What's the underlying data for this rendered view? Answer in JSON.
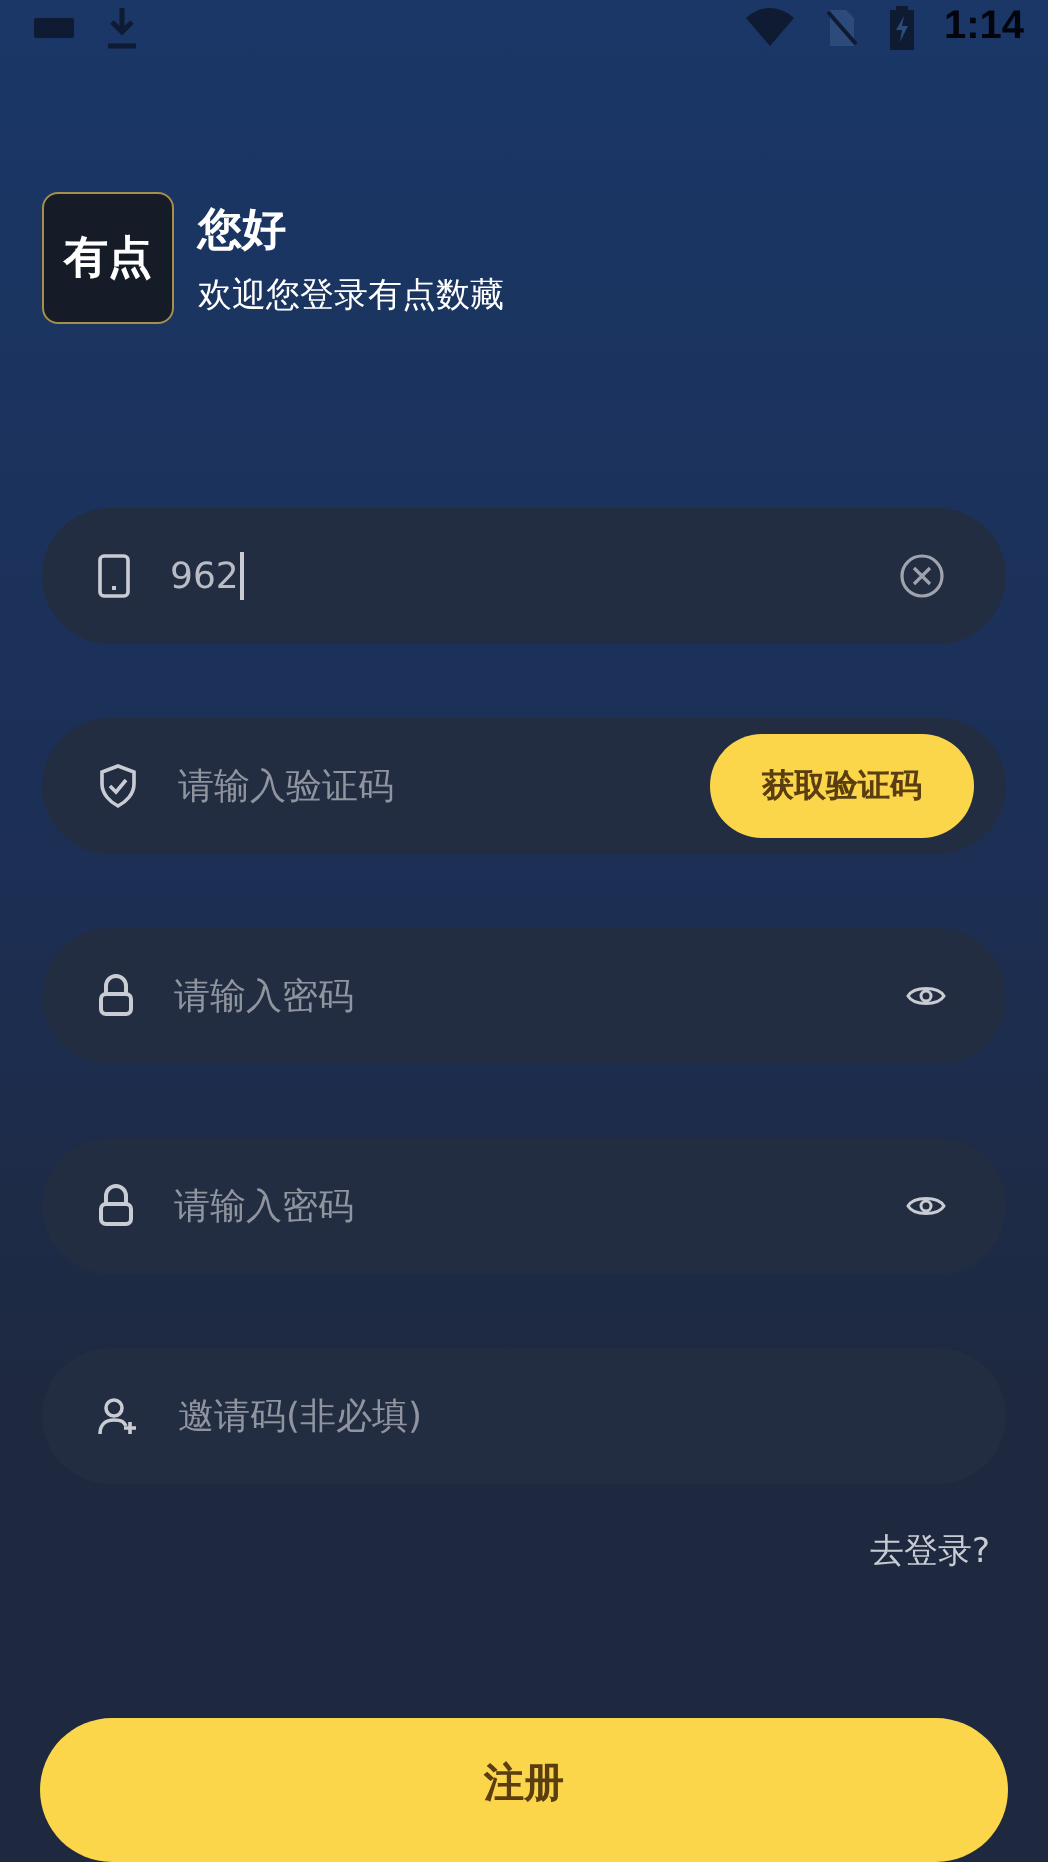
{
  "status_bar": {
    "time": "1:14"
  },
  "header": {
    "logo_text": "有点",
    "title": "您好",
    "subtitle": "欢迎您登录有点数藏"
  },
  "fields": [
    {
      "kind": "phone",
      "value": "962"
    },
    {
      "kind": "code",
      "placeholder": "请输入验证码",
      "button": "获取验证码"
    },
    {
      "kind": "password",
      "placeholder": "请输入密码"
    },
    {
      "kind": "password",
      "placeholder": "请输入密码"
    },
    {
      "kind": "invite",
      "placeholder": "邀请码(非必填)"
    }
  ],
  "login_link": "去登录?",
  "register_button": "注册"
}
